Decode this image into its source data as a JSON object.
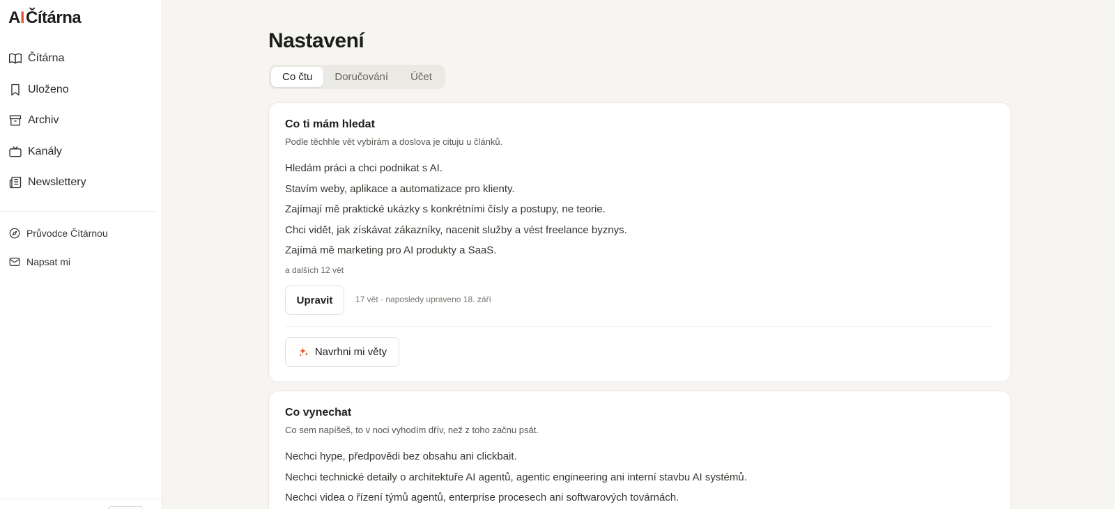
{
  "logo": {
    "ai": "A",
    "ai_i": "I",
    "name": "Čítárna",
    "accent": "#e2572f"
  },
  "sidebar": {
    "items": [
      {
        "label": "Čítárna",
        "icon": "book-icon"
      },
      {
        "label": "Uloženo",
        "icon": "bookmark-icon"
      },
      {
        "label": "Archiv",
        "icon": "archive-icon"
      },
      {
        "label": "Kanály",
        "icon": "tv-icon"
      },
      {
        "label": "Newslettery",
        "icon": "newspaper-icon"
      }
    ],
    "secondary": [
      {
        "label": "Průvodce Čítárnou",
        "icon": "compass-icon"
      },
      {
        "label": "Napsat mi",
        "icon": "mail-icon"
      }
    ]
  },
  "page": {
    "title": "Nastavení"
  },
  "tabs": [
    {
      "label": "Co čtu",
      "active": true
    },
    {
      "label": "Doručování",
      "active": false
    },
    {
      "label": "Účet",
      "active": false
    }
  ],
  "include": {
    "title": "Co ti mám hledat",
    "subtitle": "Podle těchhle vět vybírám a doslova je cituju u článků.",
    "sentences": [
      "Hledám práci a chci podnikat s AI.",
      "Stavím weby, aplikace a automatizace pro klienty.",
      "Zajímají mě praktické ukázky s konkrétními čísly a postupy, ne teorie.",
      "Chci vidět, jak získávat zákazníky, nacenit služby a vést freelance byznys.",
      "Zajímá mě marketing pro AI produkty a SaaS."
    ],
    "more": "a dalších 12 vět",
    "edit_label": "Upravit",
    "meta": "17 vět · naposledy upraveno 18. září",
    "suggest_label": "Navrhni mi věty"
  },
  "exclude": {
    "title": "Co vynechat",
    "subtitle": "Co sem napíšeš, to v noci vyhodím dřív, než z toho začnu psát.",
    "sentences": [
      "Nechci hype, předpovědi bez obsahu ani clickbait.",
      "Nechci technické detaily o architektuře AI agentů, agentic engineering ani interní stavbu AI systémů.",
      "Nechci videa o řízení týmů agentů, enterprise procesech ani softwarových továrnách."
    ]
  }
}
